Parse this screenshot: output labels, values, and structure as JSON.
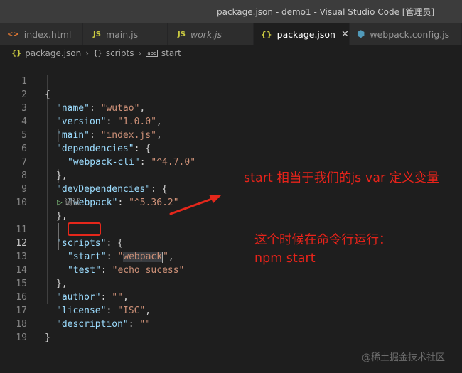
{
  "window": {
    "title": "package.json - demo1 - Visual Studio Code [管理员]"
  },
  "tabs": [
    {
      "label": "index.html",
      "icon": "html-file-icon",
      "active": false
    },
    {
      "label": "main.js",
      "icon": "js-file-icon",
      "active": false
    },
    {
      "label": "work.js",
      "icon": "js-file-icon",
      "active": false
    },
    {
      "label": "package.json",
      "icon": "json-file-icon",
      "active": true
    },
    {
      "label": "webpack.config.js",
      "icon": "webpack-file-icon",
      "active": false
    }
  ],
  "breadcrumb": {
    "file": "package.json",
    "object": "scripts",
    "symbol": "start",
    "symbol_icon": "abc"
  },
  "icons": {
    "html": "<>",
    "js": "JS",
    "json": "{}",
    "close": "✕",
    "play": "▷",
    "chevron": "›",
    "cube": "⬢"
  },
  "codelens": "调试",
  "line_numbers": [
    "1",
    "2",
    "3",
    "4",
    "5",
    "6",
    "7",
    "8",
    "9",
    "10",
    "11",
    "12",
    "13",
    "14",
    "15",
    "16",
    "17",
    "18",
    "19"
  ],
  "code_lines": [
    "{",
    "\"name\": \"wutao\",",
    "\"version\": \"1.0.0\",",
    "\"main\": \"index.js\",",
    "\"dependencies\": {",
    "\"webpack-cli\": \"^4.7.0\"",
    "},",
    "\"devDependencies\": {",
    "\"webpack\": \"^5.36.2\"",
    "},",
    "\"scripts\": {",
    "\"start\": \"webpack\",",
    "\"test\": \"echo sucess\"",
    "},",
    "\"author\": \"\",",
    "\"license\": \"ISC\",",
    "\"description\": \"\"",
    "}",
    ""
  ],
  "annotations": {
    "note1": "start 相当于我们的js var 定义变量",
    "note2_line1": "这个时候在命令行运行：",
    "note2_line2": "npm  start"
  },
  "watermark": "@稀土掘金技术社区",
  "colors": {
    "annotation": "#e8231a",
    "key": "#9cdcfe",
    "string": "#ce9178",
    "background": "#1e1e1e"
  }
}
